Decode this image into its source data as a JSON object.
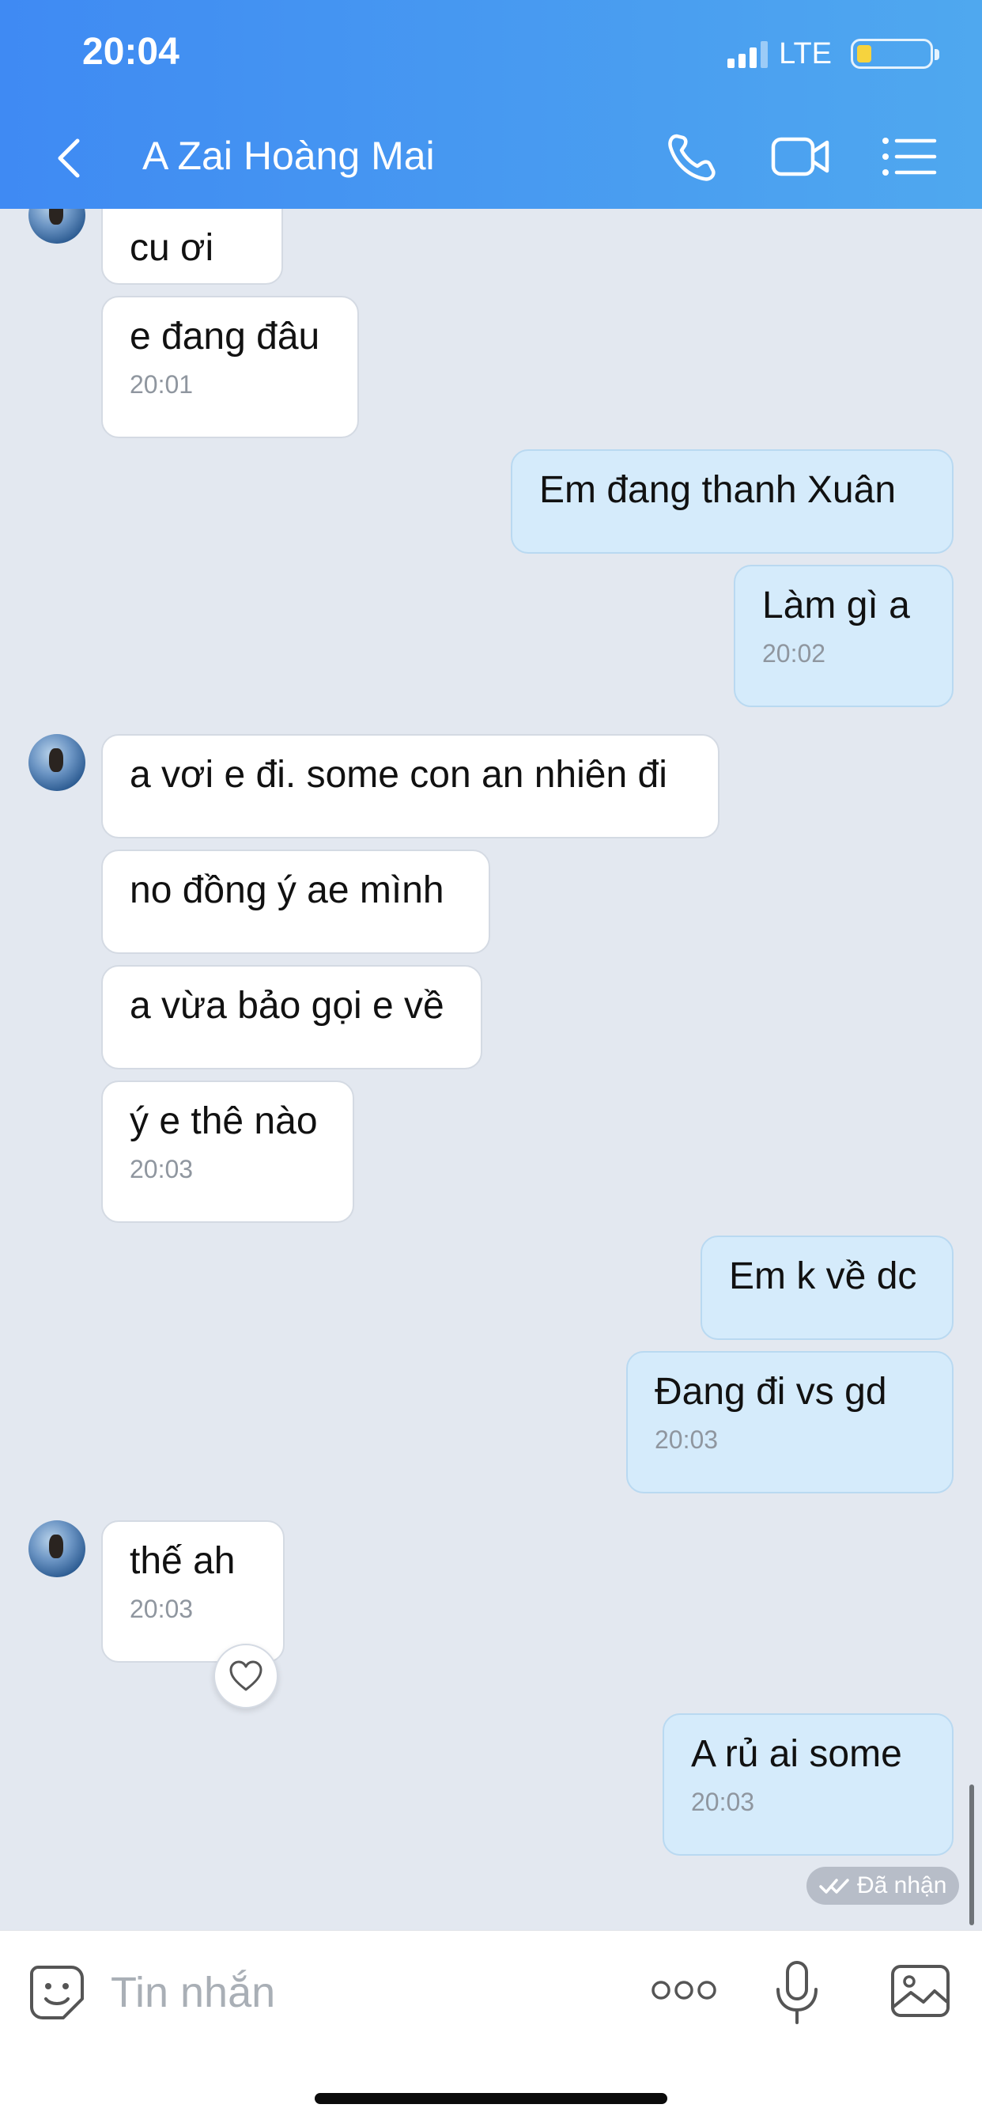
{
  "status_bar": {
    "time": "20:04",
    "network": "LTE",
    "battery_level": 0.2
  },
  "header": {
    "title": "A Zai Hoàng Mai",
    "icons": [
      "back-icon",
      "phone-icon",
      "video-call-icon",
      "menu-list-icon"
    ]
  },
  "messages": [
    {
      "side": "received",
      "text": "cu ơi",
      "time": ""
    },
    {
      "side": "received",
      "text": "e đang đâu",
      "time": "20:01"
    },
    {
      "side": "sent",
      "text": "Em đang thanh Xuân",
      "time": ""
    },
    {
      "side": "sent",
      "text": "Làm gì a",
      "time": "20:02"
    },
    {
      "side": "received",
      "text": "a vơi e đi. some con an nhiên đi",
      "time": ""
    },
    {
      "side": "received",
      "text": "no đồng ý ae mình",
      "time": ""
    },
    {
      "side": "received",
      "text": "a vừa bảo gọi e về",
      "time": ""
    },
    {
      "side": "received",
      "text": "ý e thê nào",
      "time": "20:03"
    },
    {
      "side": "sent",
      "text": "Em k về dc",
      "time": ""
    },
    {
      "side": "sent",
      "text": "Đang đi vs gd",
      "time": "20:03"
    },
    {
      "side": "received",
      "text": "thế ah",
      "time": "20:03"
    },
    {
      "side": "sent",
      "text": "A rủ ai some",
      "time": "20:03"
    }
  ],
  "delivery_status": "Đã nhận",
  "composer": {
    "placeholder": "Tin nhắn",
    "icons": [
      "sticker-icon",
      "more-icon",
      "microphone-icon",
      "image-icon"
    ]
  },
  "colors": {
    "header_start": "#3F8AF3",
    "header_end": "#4FA8EF",
    "chat_background": "#E3E8F0",
    "received_bubble": "#FFFFFF",
    "sent_bubble": "#D5EBFB",
    "battery": "#F6D33E"
  }
}
